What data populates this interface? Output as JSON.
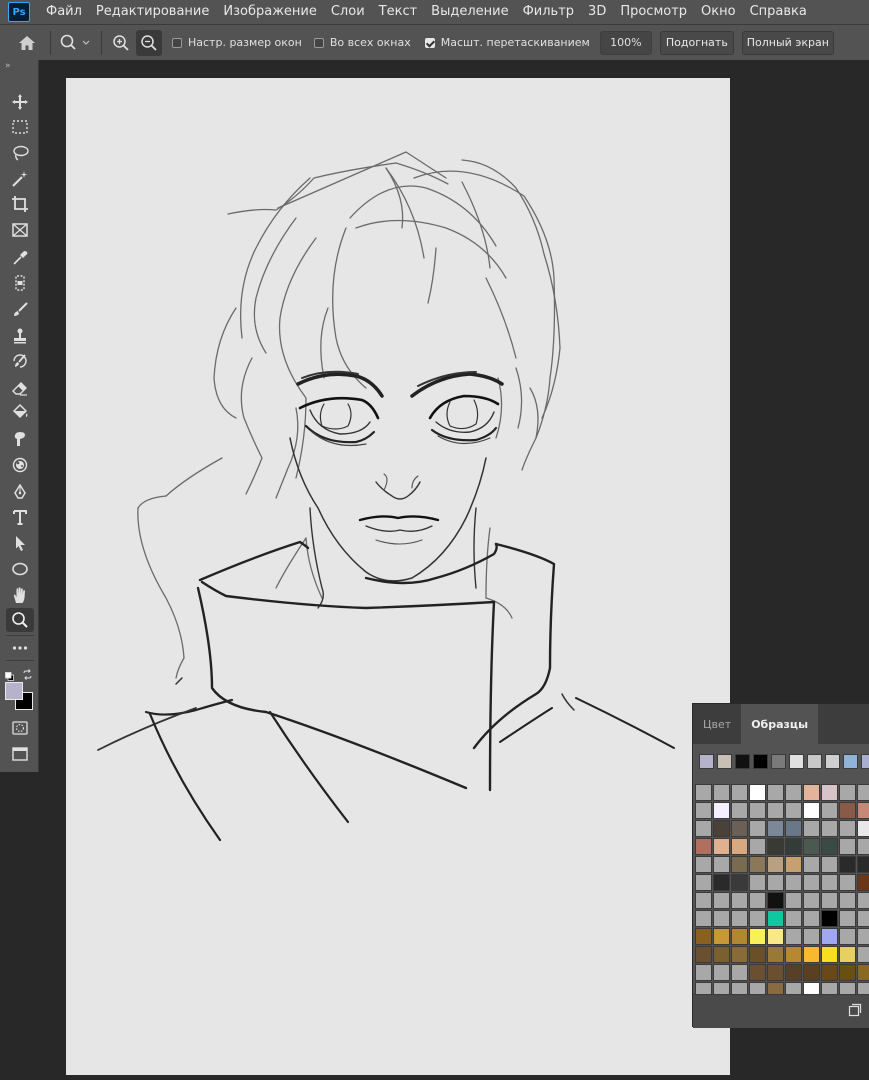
{
  "app": {
    "logo": "Ps"
  },
  "menu": [
    "Файл",
    "Редактирование",
    "Изображение",
    "Слои",
    "Текст",
    "Выделение",
    "Фильтр",
    "3D",
    "Просмотр",
    "Окно",
    "Справка"
  ],
  "options": {
    "resize_windows": "Настр. размер окон",
    "all_windows": "Во всех окнах",
    "scrubby_zoom": "Масшт. перетаскиванием",
    "zoom_value": "100%",
    "fit_button": "Подогнать",
    "fullscreen_button": "Полный экран",
    "resize_windows_checked": false,
    "all_windows_checked": false,
    "scrubby_zoom_checked": true
  },
  "tools": [
    "move-icon",
    "marquee-icon",
    "lasso-icon",
    "magic-wand-icon",
    "crop-icon",
    "frame-icon",
    "eyedropper-icon",
    "healing-icon",
    "brush-icon",
    "stamp-icon",
    "history-brush-icon",
    "eraser-icon",
    "paint-bucket-icon",
    "smudge-icon",
    "dodge-icon",
    "pen-icon",
    "type-icon",
    "path-select-icon",
    "ellipse-icon",
    "hand-icon",
    "zoom-icon",
    "more-tools-icon"
  ],
  "colors": {
    "foreground": "#b5b3cc",
    "background": "#000000",
    "canvas": "#e6e6e6",
    "ui_dark": "#535353"
  },
  "panel": {
    "tabs": [
      "Цвет",
      "Образцы"
    ],
    "active_tab": 1,
    "recent": [
      "#b5b3cc",
      "#c8c0b4",
      "#111111",
      "#000000",
      "#7a7a7a",
      "#e0e0e0",
      "#c8c8c8",
      "#cfcfcf",
      "#8fb4d8",
      "#a8aed0"
    ],
    "grid": [
      "#a8a8a8",
      "#a8a8a8",
      "#a8a8a8",
      "#ffffff",
      "#a8a8a8",
      "#a8a8a8",
      "#e4b49a",
      "#d8c4c8",
      "#a8a8a8",
      "#a8a8a8",
      "#a8a8a8",
      "#f4f0ff",
      "#a8a8a8",
      "#a8a8a8",
      "#a8a8a8",
      "#a8a8a8",
      "#ffffff",
      "#a8a8a8",
      "#8a5a48",
      "#c88878",
      "#a8a8a8",
      "#4a4238",
      "#6a6058",
      "#a8a8a8",
      "#7a8898",
      "#687888",
      "#a8a8a8",
      "#a8a8a8",
      "#a8a8a8",
      "#e8e8e8",
      "#b07060",
      "#e0b090",
      "#d8a880",
      "#a8a8a8",
      "#3a3a34",
      "#343c3a",
      "#4a5a50",
      "#3a4a44",
      "#a8a8a8",
      "#a8a8a8",
      "#a8a8a8",
      "#a8a8a8",
      "#7a6a50",
      "#8a7858",
      "#b8a080",
      "#c8a070",
      "#a8a8a8",
      "#a8a8a8",
      "#2a2a2a",
      "#2a2a2a",
      "#a8a8a8",
      "#2a2a2a",
      "#3a3a3a",
      "#a8a8a8",
      "#a8a8a8",
      "#a8a8a8",
      "#a8a8a8",
      "#a8a8a8",
      "#a8a8a8",
      "#6a3818",
      "#a8a8a8",
      "#a8a8a8",
      "#a8a8a8",
      "#a8a8a8",
      "#111111",
      "#a8a8a8",
      "#a8a8a8",
      "#a8a8a8",
      "#a8a8a8",
      "#a8a8a8",
      "#a8a8a8",
      "#a8a8a8",
      "#a8a8a8",
      "#a8a8a8",
      "#10c8a0",
      "#a8a8a8",
      "#a8a8a8",
      "#000000",
      "#a8a8a8",
      "#a8a8a8",
      "#8a6020",
      "#c89838",
      "#b08830",
      "#f8f058",
      "#f8e888",
      "#a8a8a8",
      "#a8a8a8",
      "#a0a8f0",
      "#a8a8a8",
      "#a8a8a8",
      "#6a5030",
      "#7a6030",
      "#8a6a38",
      "#6a5028",
      "#9a7838",
      "#b88830",
      "#f8b830",
      "#f8e020",
      "#e8d060",
      "#a8a8a8",
      "#a8a8a8",
      "#a8a8a8",
      "#a8a8a8",
      "#6a5030",
      "#6a5030",
      "#584028",
      "#5a4020",
      "#6a4818",
      "#6a5010",
      "#8a6a20",
      "#a8a8a8",
      "#a8a8a8",
      "#a8a8a8",
      "#a8a8a8",
      "#8a6a40",
      "#a8a8a8",
      "#ffffff",
      "#a8a8a8",
      "#a8a8a8",
      "#a8a8a8"
    ]
  }
}
